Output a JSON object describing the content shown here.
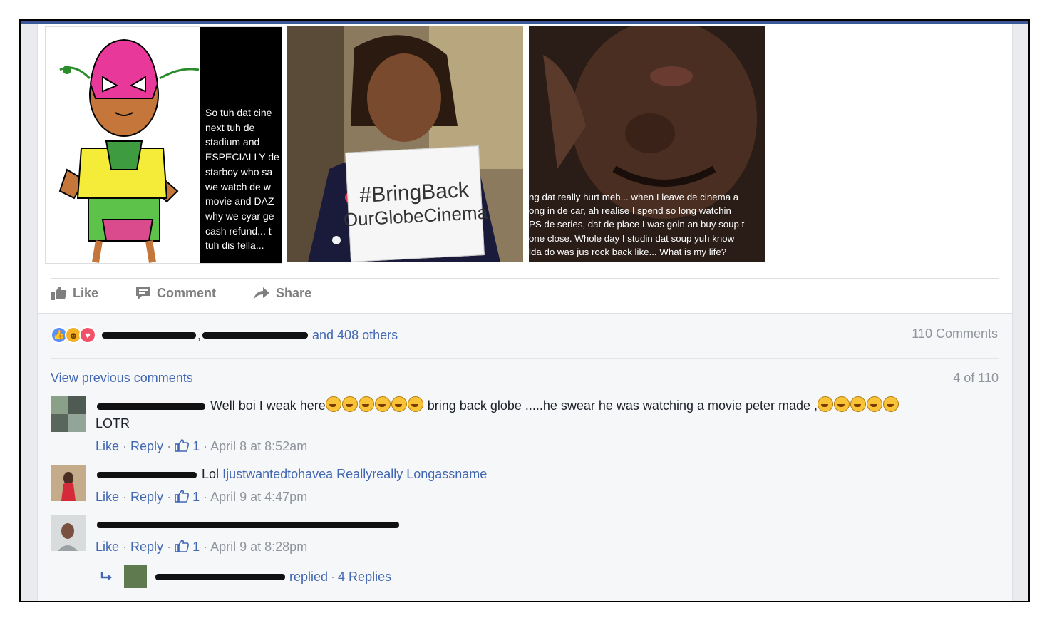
{
  "photos": {
    "photo1_text": "So tuh dat cine\nnext tuh de\nstadium and\nESPECIALLY de\nstarboy who sa\nwe watch de w\nmovie and DAZ\nwhy we cyar ge\ncash refund... t\ntuh dis fella...",
    "photo2_sign_line1": "#BringBack",
    "photo2_sign_line2": "OurGlobeCinema",
    "photo3_text": "ng dat really hurt meh... when I leave de cinema a\nong in de car, ah realise I spend so long watchin\nPS de series, dat de place I was goin an buy soup t\none close. Whole day I studin dat soup yuh know\nlda do was jus rock back like... What is my life?"
  },
  "actions": {
    "like": "Like",
    "comment": "Comment",
    "share": "Share"
  },
  "reactions_summary": {
    "others": "and 408 others",
    "comments_total": "110 Comments"
  },
  "comments_header": {
    "view_previous": "View previous comments",
    "count": "4 of 110"
  },
  "comments": [
    {
      "text_part1": "Well boi I weak here",
      "text_part2": " bring back globe .....he swear he was watching a movie peter made ,",
      "text_line2": "LOTR",
      "like": "Like",
      "reply": "Reply",
      "likes": "1",
      "time": "April 8 at 8:52am"
    },
    {
      "text": "Lol",
      "linked_name": "Ijustwantedtohavea Reallyreally Longassname",
      "like": "Like",
      "reply": "Reply",
      "likes": "1",
      "time": "April 9 at 4:47pm"
    },
    {
      "like": "Like",
      "reply": "Reply",
      "likes": "1",
      "time": "April 9 at 8:28pm"
    }
  ],
  "reply_thread": {
    "replied": "replied",
    "replies": "4 Replies"
  },
  "colors": {
    "link": "#4267b2",
    "muted": "#90949c",
    "facebook_blue": "#3b5998"
  }
}
